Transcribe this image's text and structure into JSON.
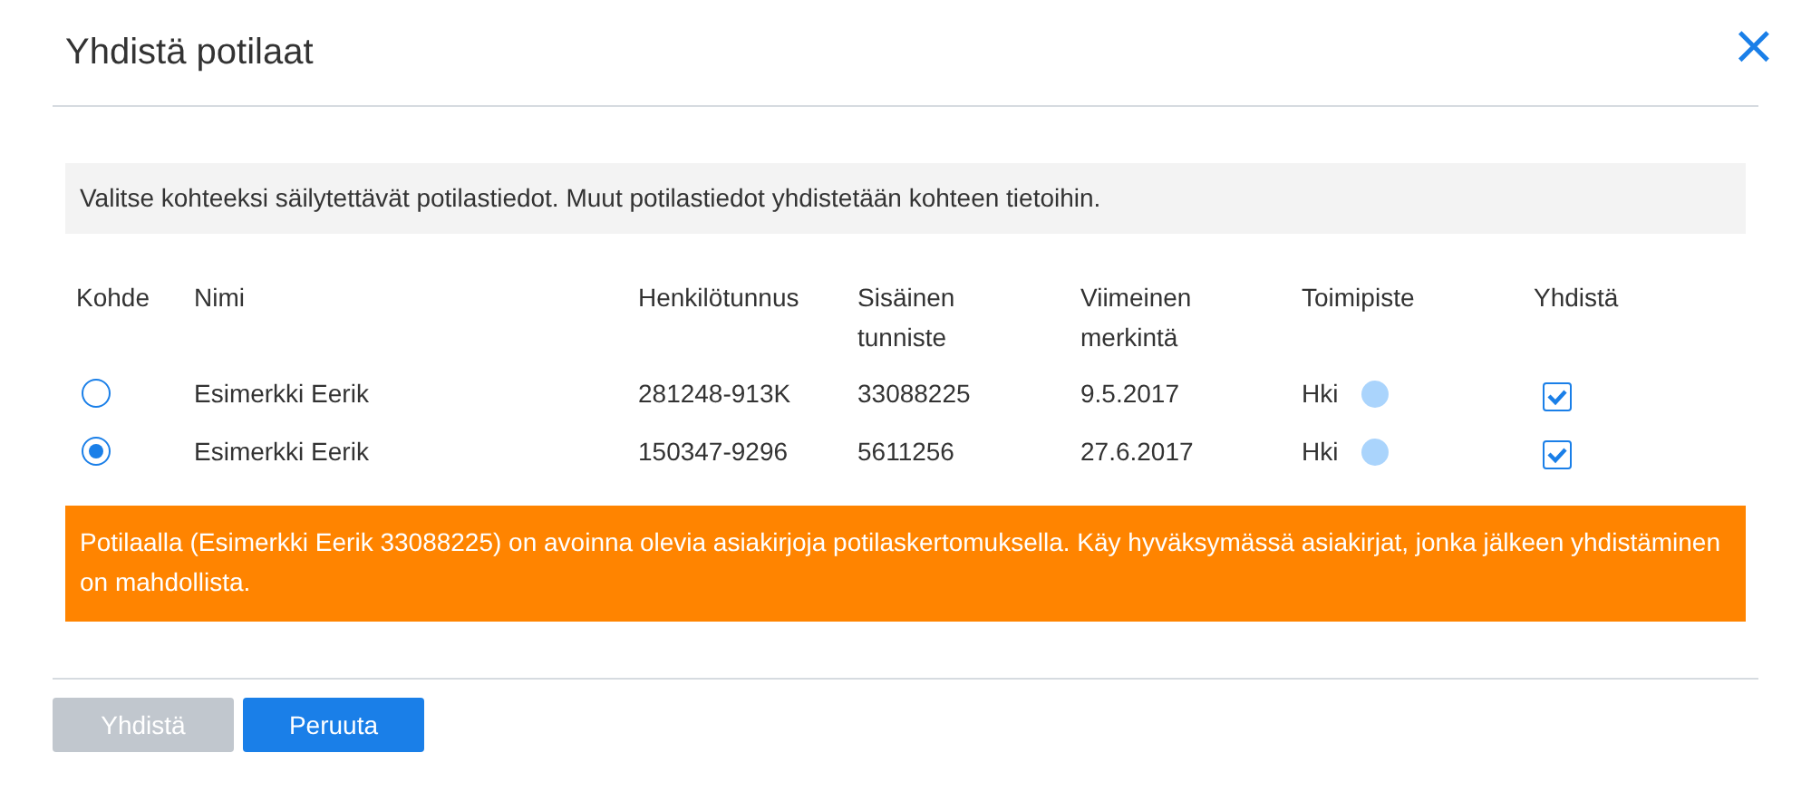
{
  "dialog": {
    "title": "Yhdistä potilaat",
    "close": "×"
  },
  "info": "Valitse kohteeksi säilytettävät potilastiedot. Muut potilastiedot yhdistetään kohteen tietoihin.",
  "table": {
    "columns": [
      "Kohde",
      "Nimi",
      "Henkilötunnus",
      "Sisäinen tunniste",
      "Viimeinen merkintä",
      "Toimipiste",
      "Yhdistä"
    ],
    "rows": [
      {
        "selected": false,
        "name": "Esimerkki Eerik",
        "ssn": "281248-913K",
        "internal_id": "33088225",
        "last_entry": "9.5.2017",
        "office": "Hki",
        "color": "#aad4fc",
        "merge": true
      },
      {
        "selected": true,
        "name": "Esimerkki Eerik",
        "ssn": "150347-9296",
        "internal_id": "5611256",
        "last_entry": "27.6.2017",
        "office": "Hki",
        "color": "#aad4fc",
        "merge": true
      }
    ]
  },
  "warning": "Potilaalla (Esimerkki Eerik 33088225) on avoinna olevia asiakirjoja potilaskertomuksella. Käy hyväksymässä asiakirjat, jonka jälkeen yhdistäminen on mahdollista.",
  "buttons": [
    {
      "label": "Yhdistä",
      "disabled": true
    },
    {
      "label": "Peruuta",
      "disabled": false
    }
  ]
}
